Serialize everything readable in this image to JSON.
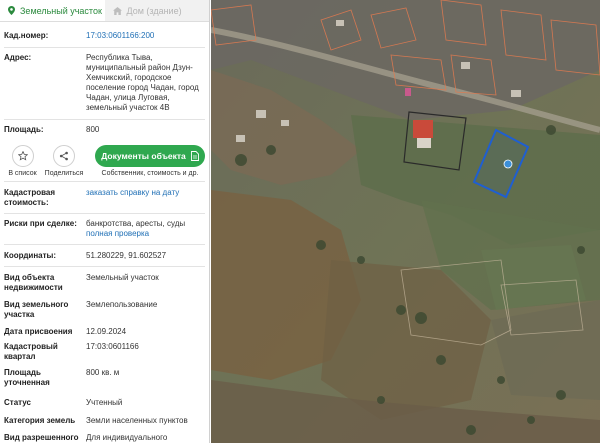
{
  "tabs": [
    {
      "label": "Земельный участок",
      "active": true
    },
    {
      "label": "Дом (здание)",
      "active": false
    }
  ],
  "fields": {
    "cadnum": {
      "label": "Кад.номер:",
      "value": "17:03:0601166:200"
    },
    "address": {
      "label": "Адрес:",
      "value": "Республика Тыва, муниципальный район Дзун-Хемчикский, городское поселение город Чадан, город Чадан, улица Луговая, земельный участок 4В"
    },
    "area": {
      "label": "Площадь:",
      "value": "800"
    },
    "cadvalue": {
      "label": "Кадастровая стоимость:",
      "value": "заказать справку на дату"
    },
    "risks": {
      "label": "Риски при сделке:",
      "value": "банкротства, аресты, суды",
      "link": "полная проверка"
    },
    "coords": {
      "label": "Координаты:",
      "value": "51.280229, 91.602527"
    },
    "objtype": {
      "label": "Вид объекта недвижимости",
      "value": "Земельный участок"
    },
    "landtype": {
      "label": "Вид земельного участка",
      "value": "Землепользование"
    },
    "assigned": {
      "label": "Дата присвоения",
      "value": "12.09.2024"
    },
    "quarter": {
      "label": "Кадастровый квартал",
      "value": "17:03:0601166"
    },
    "areaexact": {
      "label": "Площадь уточненная",
      "value": "800 кв. м"
    },
    "status": {
      "label": "Статус",
      "value": "Учтенный"
    },
    "category": {
      "label": "Категория земель",
      "value": "Земли населенных пунктов"
    },
    "permitted": {
      "label": "Вид разрешенного использования",
      "value": "Для индивидуального жилищного строительства"
    }
  },
  "actions": {
    "list_label": "В список",
    "share_label": "Поделиться",
    "docs_button": "Документы объекта",
    "docs_caption": "Собственник, стоимость и др."
  },
  "colors": {
    "accent": "#2fa84f",
    "tab_active": "#2b8a3e",
    "link": "#1f6fb5",
    "parcel_outline": "#1f5fd1"
  },
  "icons": {
    "land_tab": "pin-icon",
    "house_tab": "house-icon",
    "list": "star-icon",
    "share": "share-icon",
    "docs": "document-icon"
  }
}
